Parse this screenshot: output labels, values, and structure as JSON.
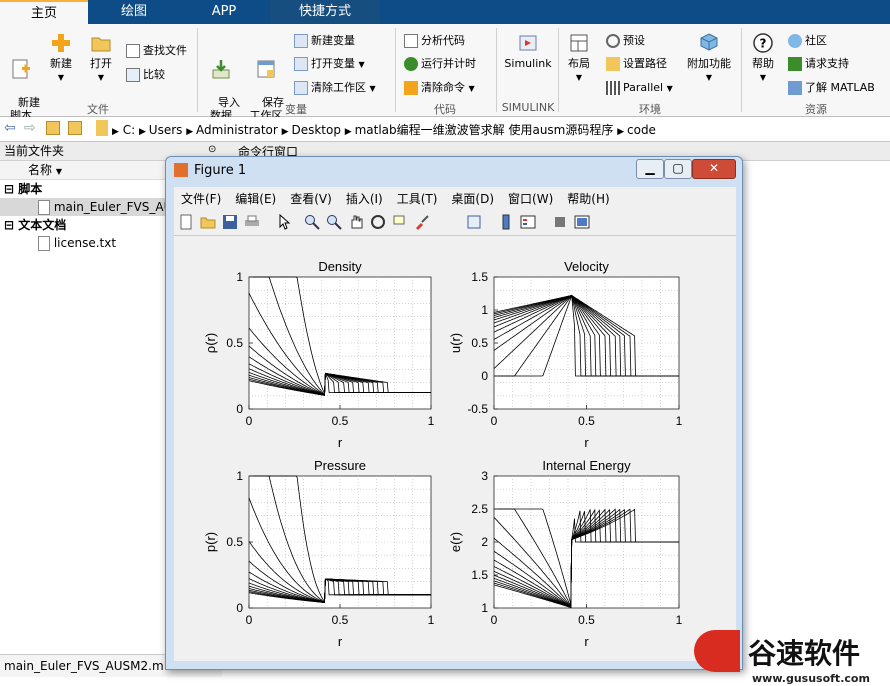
{
  "tabs": [
    {
      "label": "主页",
      "active": true
    },
    {
      "label": "绘图",
      "active": false
    },
    {
      "label": "APP",
      "active": false
    },
    {
      "label": "快捷方式",
      "active": false
    }
  ],
  "ribbon": {
    "file": {
      "new_script": "新建\n脚本",
      "new": "新建",
      "open": "打开",
      "find_files": "查找文件",
      "compare": "比较",
      "group": "文件"
    },
    "variable": {
      "import": "导入\n数据",
      "save_ws": "保存\n工作区",
      "new_var": "新建变量",
      "open_var": "打开变量",
      "clear_ws": "清除工作区",
      "group": "变量"
    },
    "code": {
      "analyze": "分析代码",
      "run_time": "运行并计时",
      "clear_cmd": "清除命令",
      "group": "代码"
    },
    "simulink": {
      "label": "Simulink",
      "group": "SIMULINK"
    },
    "env": {
      "layout": "布局",
      "prefs": "预设",
      "set_path": "设置路径",
      "parallel": "Parallel",
      "addons": "附加功能",
      "group": "环境"
    },
    "resources": {
      "help": "帮助",
      "community": "社区",
      "support": "请求支持",
      "learn": "了解 MATLAB",
      "group": "资源"
    }
  },
  "address": {
    "parts": [
      "C:",
      "Users",
      "Administrator",
      "Desktop",
      "matlab编程一维激波管求解 使用ausm源码程序",
      "code"
    ]
  },
  "left_panel": {
    "title": "当前文件夹",
    "col_name": "名称",
    "group_scripts": "脚本",
    "file_main": "main_Euler_FVS_AU",
    "group_text": "文本文档",
    "file_license": "license.txt",
    "status_file": "main_Euler_FVS_AUSM2.m"
  },
  "cmd_window_title": "命令行窗口",
  "figure": {
    "title": "Figure 1",
    "menus": [
      "文件(F)",
      "编辑(E)",
      "查看(V)",
      "插入(I)",
      "工具(T)",
      "桌面(D)",
      "窗口(W)",
      "帮助(H)"
    ]
  },
  "watermark": {
    "brand": "谷速软件",
    "url": "www.gususoft.com"
  },
  "chart_data": [
    {
      "type": "line",
      "title": "Density",
      "xlabel": "r",
      "ylabel": "ρ(r)",
      "xlim": [
        0,
        1
      ],
      "ylim": [
        0,
        1
      ],
      "xticks": [
        "0",
        "0.5",
        "1"
      ],
      "yticks": [
        "0",
        "0.5",
        "1"
      ],
      "grid": "dotted",
      "series_count": 13,
      "profile": "shock-tube density: left state 1, rarefaction, contact, shock to right state 0.125"
    },
    {
      "type": "line",
      "title": "Velocity",
      "xlabel": "r",
      "ylabel": "u(r)",
      "xlim": [
        0,
        1
      ],
      "ylim": [
        -0.5,
        1.5
      ],
      "xticks": [
        "0",
        "0.5",
        "1"
      ],
      "yticks": [
        "-0.5",
        "0",
        "0.5",
        "1",
        "1.5"
      ],
      "grid": "dotted",
      "series_count": 13,
      "profile": "velocity 0 at left, ramp up to peak ~1.2 near r≈0.44, then plateau and shock drop to 0"
    },
    {
      "type": "line",
      "title": "Pressure",
      "xlabel": "r",
      "ylabel": "p(r)",
      "xlim": [
        0,
        1
      ],
      "ylim": [
        0,
        1
      ],
      "xticks": [
        "0",
        "0.5",
        "1"
      ],
      "yticks": [
        "0",
        "0.5",
        "1"
      ],
      "grid": "dotted",
      "series_count": 13,
      "profile": "pressure left 1, rarefaction, plateau ~0.2, shock to 0.1"
    },
    {
      "type": "line",
      "title": "Internal Energy",
      "xlabel": "r",
      "ylabel": "e(r)",
      "xlim": [
        0,
        1
      ],
      "ylim": [
        1,
        3
      ],
      "xticks": [
        "0",
        "0.5",
        "1"
      ],
      "yticks": [
        "1",
        "1.5",
        "2",
        "2.5",
        "3"
      ],
      "grid": "dotted",
      "series_count": 13,
      "profile": "energy left 2.5, dip to ~1.3 near r≈0.44, jump to ~2.7, shock drop to 2"
    }
  ]
}
